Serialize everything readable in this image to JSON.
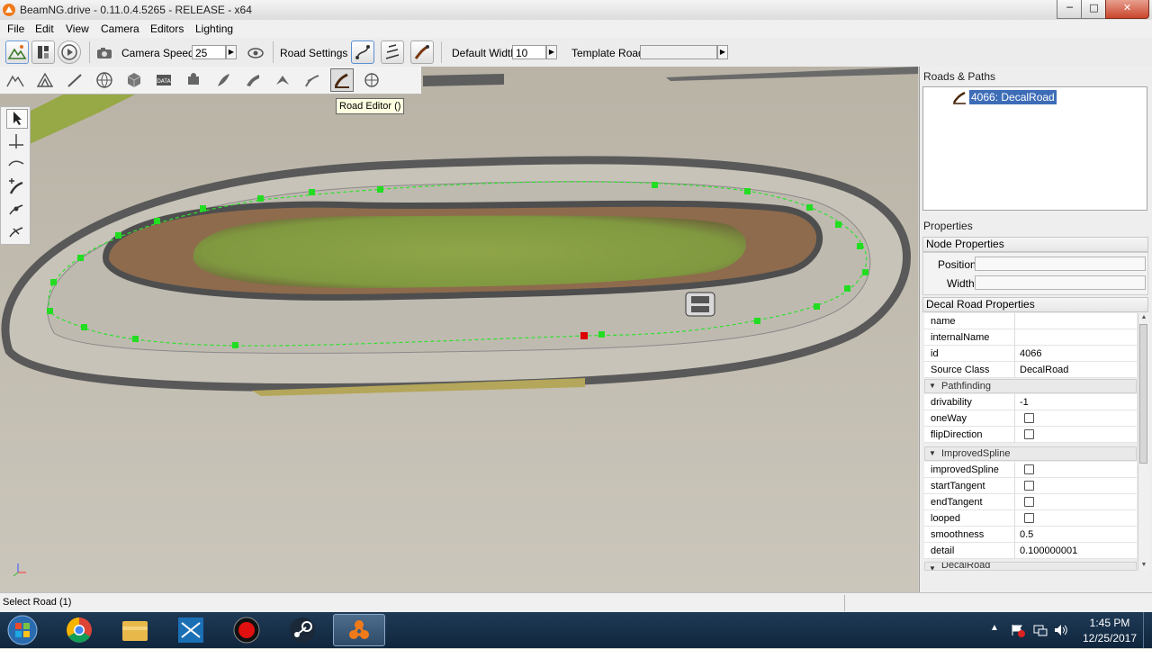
{
  "window": {
    "title": "BeamNG.drive - 0.11.0.4.5265 - RELEASE - x64",
    "minimize": "─",
    "maximize": "□",
    "close": "✕"
  },
  "menu": [
    "File",
    "Edit",
    "View",
    "Camera",
    "Editors",
    "Lighting"
  ],
  "toolbar": {
    "camera_speed_label": "Camera Speed",
    "camera_speed_value": "25",
    "road_settings_label": "Road Settings",
    "default_width_label": "Default Width",
    "default_width_value": "10",
    "template_road_label": "Template Road",
    "template_road_value": ""
  },
  "tooltip": "Road Editor ()",
  "roads_panel": {
    "header": "Roads & Paths",
    "items": [
      {
        "label": "4066: DecalRoad",
        "icon": "road-editor-icon",
        "selected": true
      }
    ]
  },
  "properties": {
    "header": "Properties",
    "node_group": "Node Properties",
    "node_fields": [
      {
        "label": "Position",
        "value": ""
      },
      {
        "label": "Width",
        "value": ""
      }
    ],
    "decal_group": "Decal Road Properties",
    "rows": [
      {
        "name": "name",
        "value": ""
      },
      {
        "name": "internalName",
        "value": ""
      },
      {
        "name": "id",
        "value": "4066"
      },
      {
        "name": "Source Class",
        "value": "DecalRoad"
      }
    ],
    "pathfinding_header": "Pathfinding",
    "pathfinding_rows": [
      {
        "name": "drivability",
        "value": "-1"
      },
      {
        "name": "oneWay",
        "checkbox": true,
        "checked": false
      },
      {
        "name": "flipDirection",
        "checkbox": true,
        "checked": false
      }
    ],
    "spline_header": "ImprovedSpline",
    "spline_rows": [
      {
        "name": "improvedSpline",
        "checkbox": true,
        "checked": false
      },
      {
        "name": "startTangent",
        "checkbox": true,
        "checked": false
      },
      {
        "name": "endTangent",
        "checkbox": true,
        "checked": false
      },
      {
        "name": "looped",
        "checkbox": true,
        "checked": false
      },
      {
        "name": "smoothness",
        "value": "0.5"
      },
      {
        "name": "detail",
        "value": "0.100000001"
      }
    ],
    "decalroad_header": "DecalRoad"
  },
  "status": {
    "text": "Select Road (1)"
  },
  "taskbar": {
    "time": "1:45 PM",
    "date": "12/25/2017",
    "apps": [
      "start-orb-icon",
      "chrome-icon",
      "file-explorer-icon",
      "video-editor-icon",
      "recorder-icon",
      "steam-icon",
      "beamng-icon"
    ]
  },
  "colors": {
    "selection": "#3d6db7",
    "node_green": "#22dd22",
    "node_selected": "#dd0000",
    "taskbar": "#15304a"
  }
}
